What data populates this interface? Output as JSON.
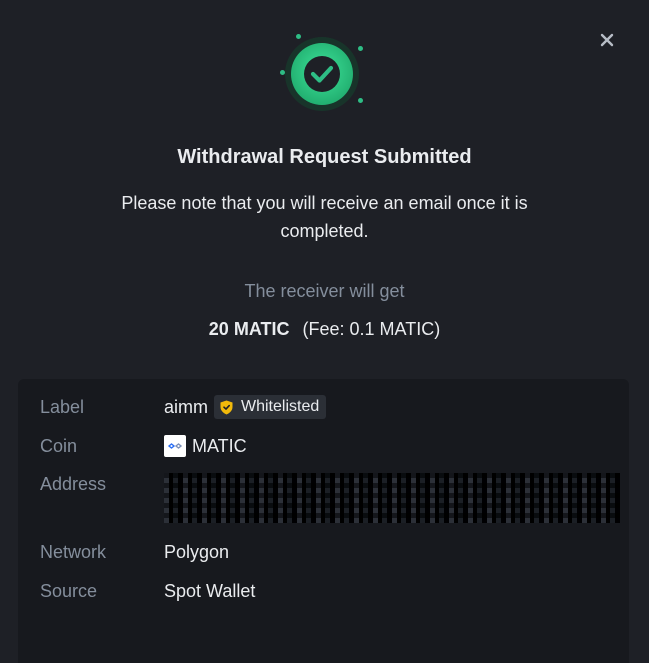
{
  "modal": {
    "close_icon": "close-icon",
    "status_icon": "success-check-icon",
    "title": "Withdrawal Request Submitted",
    "note": "Please note that you will receive an email once it is completed.",
    "receiver_label": "The receiver will get",
    "amount": "20 MATIC",
    "fee": "(Fee: 0.1 MATIC)"
  },
  "details": {
    "label": {
      "key": "Label",
      "value": "aimm",
      "badge": "Whitelisted",
      "badge_icon": "shield-icon"
    },
    "coin": {
      "key": "Coin",
      "value": "MATIC",
      "icon": "matic-coin-icon"
    },
    "address": {
      "key": "Address",
      "value_obscured": true
    },
    "network": {
      "key": "Network",
      "value": "Polygon"
    },
    "source": {
      "key": "Source",
      "value": "Spot Wallet"
    }
  },
  "colors": {
    "background": "#1e2026",
    "panel": "#17191e",
    "success": "#2ebd85",
    "badge_yellow": "#f0b90b",
    "text_primary": "#eaecef",
    "text_secondary": "#848e9c"
  }
}
